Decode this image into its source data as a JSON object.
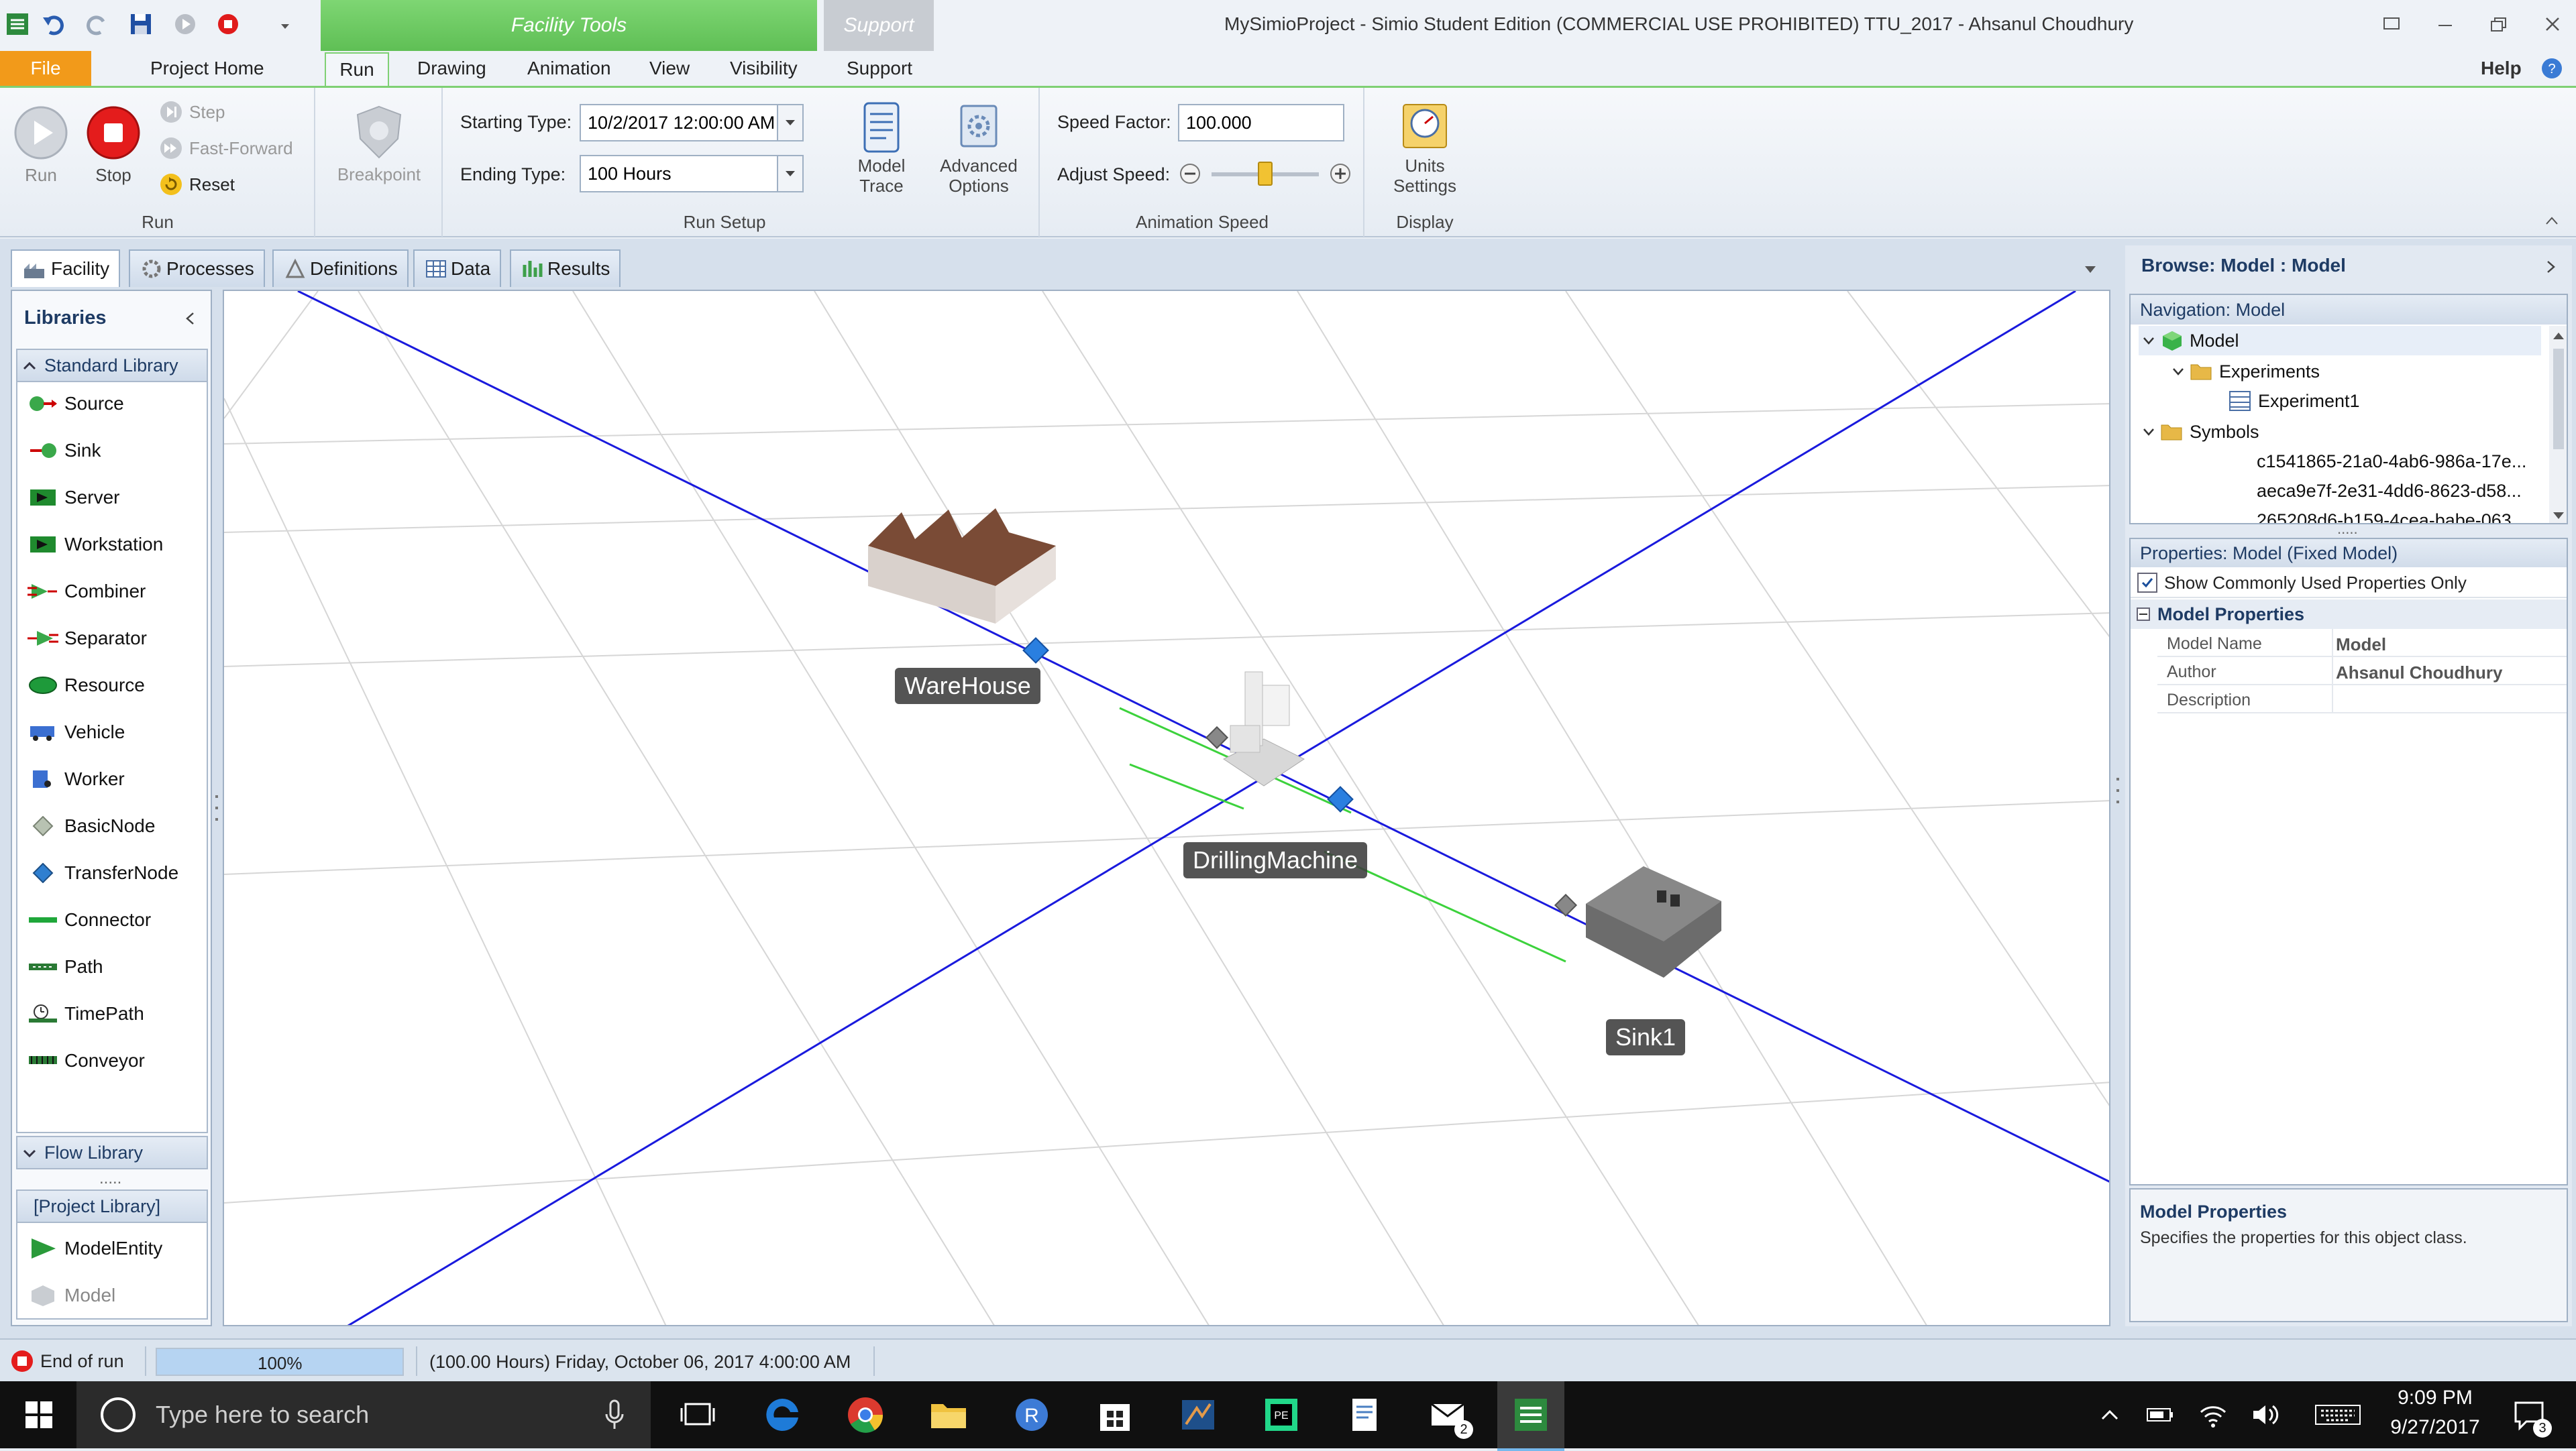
{
  "window": {
    "title": "MySimioProject - Simio Student Edition (COMMERCIAL USE PROHIBITED) TTU_2017 - Ahsanul Choudhury",
    "context_tab_facility": "Facility Tools",
    "context_tab_support": "Support",
    "help": "Help"
  },
  "menu_tabs": {
    "file": "File",
    "project_home": "Project Home",
    "run": "Run",
    "drawing": "Drawing",
    "animation": "Animation",
    "view": "View",
    "visibility": "Visibility",
    "support": "Support"
  },
  "ribbon": {
    "run_group": {
      "run": "Run",
      "stop": "Stop",
      "step": "Step",
      "fast_forward": "Fast-Forward",
      "reset": "Reset",
      "label": "Run"
    },
    "breakpoint": "Breakpoint",
    "run_setup": {
      "starting_type_label": "Starting Type:",
      "starting_type_value": "10/2/2017 12:00:00 AM",
      "ending_type_label": "Ending Type:",
      "ending_type_value": "100 Hours",
      "model_trace_1": "Model",
      "model_trace_2": "Trace",
      "advanced_1": "Advanced",
      "advanced_2": "Options",
      "label": "Run Setup"
    },
    "animation_speed": {
      "speed_factor_label": "Speed Factor:",
      "speed_factor_value": "100.000",
      "adjust_speed_label": "Adjust Speed:",
      "slider_fraction": 0.5,
      "label": "Animation Speed"
    },
    "display": {
      "units_1": "Units",
      "units_2": "Settings",
      "label": "Display"
    }
  },
  "view_tabs": [
    "Facility",
    "Processes",
    "Definitions",
    "Data",
    "Results"
  ],
  "libraries": {
    "header": "Libraries",
    "standard_library": "Standard Library",
    "items": [
      {
        "label": "Source",
        "icon": "source-icon"
      },
      {
        "label": "Sink",
        "icon": "sink-icon"
      },
      {
        "label": "Server",
        "icon": "server-icon"
      },
      {
        "label": "Workstation",
        "icon": "workstation-icon"
      },
      {
        "label": "Combiner",
        "icon": "combiner-icon"
      },
      {
        "label": "Separator",
        "icon": "separator-icon"
      },
      {
        "label": "Resource",
        "icon": "resource-icon"
      },
      {
        "label": "Vehicle",
        "icon": "vehicle-icon"
      },
      {
        "label": "Worker",
        "icon": "worker-icon"
      },
      {
        "label": "BasicNode",
        "icon": "basic-node-icon"
      },
      {
        "label": "TransferNode",
        "icon": "transfer-node-icon"
      },
      {
        "label": "Connector",
        "icon": "connector-icon"
      },
      {
        "label": "Path",
        "icon": "path-icon"
      },
      {
        "label": "TimePath",
        "icon": "time-path-icon"
      },
      {
        "label": "Conveyor",
        "icon": "conveyor-icon"
      }
    ],
    "flow_library": "Flow Library",
    "project_library": "[Project Library]",
    "project_items": [
      {
        "label": "ModelEntity",
        "icon": "model-entity-icon"
      },
      {
        "label": "Model",
        "icon": "model-icon"
      }
    ]
  },
  "canvas": {
    "objects": {
      "warehouse": "WareHouse",
      "drilling": "DrillingMachine",
      "sink": "Sink1"
    }
  },
  "browse": {
    "title": "Browse: Model : Model",
    "navigation_header": "Navigation: Model",
    "tree": {
      "model": "Model",
      "experiments": "Experiments",
      "experiment1": "Experiment1",
      "symbols": "Symbols",
      "symbol1": "c1541865-21a0-4ab6-986a-17e...",
      "symbol2": "aeca9e7f-2e31-4dd6-8623-d58...",
      "symbol3": "265208d6-b159-4cea-babe-063..."
    },
    "properties_header": "Properties: Model (Fixed Model)",
    "show_common": "Show Commonly Used Properties Only",
    "model_properties": "Model Properties",
    "props": [
      {
        "name": "Model Name",
        "value": "Model"
      },
      {
        "name": "Author",
        "value": "Ahsanul Choudhury"
      },
      {
        "name": "Description",
        "value": ""
      }
    ],
    "help_title": "Model Properties",
    "help_text": "Specifies the properties for this object class."
  },
  "status_bar": {
    "state": "End of run",
    "progress_text": "100%",
    "progress_fraction": 1.0,
    "time": "(100.00 Hours) Friday, October 06, 2017 4:00:00 AM"
  },
  "taskbar": {
    "search_placeholder": "Type here to search",
    "time": "9:09 PM",
    "date": "9/27/2017",
    "mail_badge": "2",
    "notif_badge": "3"
  },
  "colors": {
    "accent_green": "#6fcf62",
    "file_orange": "#f29a1a",
    "path_green": "#3cd23c",
    "grid_blue": "#1a1add",
    "taskbar": "#101010"
  }
}
